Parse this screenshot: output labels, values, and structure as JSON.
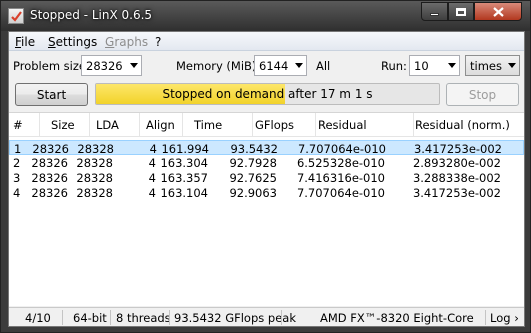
{
  "window": {
    "title": "Stopped - LinX 0.6.5"
  },
  "menu": {
    "file": {
      "hotkey": "F",
      "rest": "ile"
    },
    "settings": {
      "hotkey": "S",
      "rest": "ettings"
    },
    "graphs": {
      "hotkey": "G",
      "rest": "raphs"
    },
    "help": "?"
  },
  "controls": {
    "problem_size_label": "Problem size:",
    "problem_size_value": "28326",
    "memory_label": "Memory (MiB):",
    "memory_value": "6144",
    "memory_all": "All",
    "run_label": "Run:",
    "run_value": "10",
    "run_unit": "times",
    "start_label": "Start",
    "stop_label": "Stop"
  },
  "progress": {
    "fraction": 0.55,
    "text": "Stopped on demand after 17 m 1 s"
  },
  "table": {
    "columns": [
      "#",
      "Size",
      "LDA",
      "Align",
      "Time",
      "GFlops",
      "Residual",
      "Residual (norm.)"
    ],
    "rows": [
      [
        "1",
        "28326",
        "28328",
        "4",
        "161.994",
        "93.5432",
        "7.707064e-010",
        "3.417253e-002"
      ],
      [
        "2",
        "28326",
        "28328",
        "4",
        "163.304",
        "92.7928",
        "6.525328e-010",
        "2.893280e-002"
      ],
      [
        "3",
        "28326",
        "28328",
        "4",
        "163.357",
        "92.7625",
        "7.416316e-010",
        "3.288338e-002"
      ],
      [
        "4",
        "28326",
        "28328",
        "4",
        "163.104",
        "92.9063",
        "7.707064e-010",
        "3.417253e-002"
      ]
    ],
    "selected_row": 0
  },
  "status": {
    "progress": "4/10",
    "arch": "64-bit",
    "threads": "8 threads",
    "peak": "93.5432 GFlops peak",
    "cpu": "AMD FX™-8320 Eight-Core",
    "log": "Log ›"
  },
  "colors": {
    "progress_fill": "#f2d32a",
    "selection": "#cce8ff",
    "close_button": "#c1432b"
  }
}
